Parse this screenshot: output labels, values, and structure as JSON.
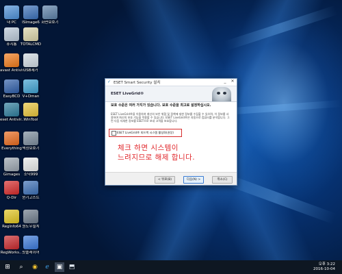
{
  "desktop": {
    "icons": [
      {
        "label": "내 PC",
        "color": "#4d8fd6"
      },
      {
        "label": "ISImage6",
        "color": "#3a6fb8"
      },
      {
        "label": "화면보호기",
        "color": "#5b7fa6"
      },
      {
        "label": "휴지통",
        "color": "#b9c7d6"
      },
      {
        "label": "TOTALCMD",
        "color": "#d9d2a8"
      },
      {
        "label": "avast Antivir...",
        "color": "#f07a1a"
      },
      {
        "label": "USB제거",
        "color": "#cfd8e0"
      },
      {
        "label": "EasyBCD",
        "color": "#2f5ea8"
      },
      {
        "label": "V+Dman",
        "color": "#3fa0d0"
      },
      {
        "label": "eset Antivir...",
        "color": "#2d7c9c"
      },
      {
        "label": "WinTool",
        "color": "#e8c33a"
      },
      {
        "label": "Everything",
        "color": "#e86a1e"
      },
      {
        "label": "액정보호기",
        "color": "#7b8b9b"
      },
      {
        "label": "Gimages",
        "color": "#9aa4ae"
      },
      {
        "label": "소닉999",
        "color": "#e8e8e8"
      },
      {
        "label": "Q-Dir",
        "color": "#d62b2b"
      },
      {
        "label": "윈기고스트",
        "color": "#3c6fb5"
      },
      {
        "label": "RegInfo64",
        "color": "#e0c420"
      },
      {
        "label": "원도우설치",
        "color": "#6d7a8a"
      },
      {
        "label": "RegWorks...",
        "color": "#c8282c"
      },
      {
        "label": "팟플레이어",
        "color": "#3a78d8"
      }
    ]
  },
  "dialog": {
    "title": "ESET Smart Security 설치",
    "header": "ESET LiveGrid®",
    "bold_text": "보호 수준은 여러 가지가 있습니다. 보호 수준을 최고로 설정하십시오.",
    "small_text": "ESET LiveGrid®을 이용하여 최신의 보안 위협 및 정책에 대한 정보를 수집할 수 있으며, 이 정보를 사용하여 최신의 보호 기능을 적용할 수 있습니다. ESET LiveGrid®은 자동으로 컴퓨터를 분석합니다. 그런 다음 자세한 정보를 ESET으로 보내 고객을 보호합니다.",
    "checkbox_label": "ESET LiveGrid® 피드백 시스템 활성화(권장)",
    "note_line1": "체크 하면 시스템이",
    "note_line2": "느려지므로 해제 합니다.",
    "back_button": "< 뒤로(B)",
    "next_button": "다음(N) >",
    "cancel_button": "취소(C)",
    "minimize": "_",
    "close": "✕"
  },
  "taskbar": {
    "start": "⊞",
    "time": "오후 3:22",
    "date": "2016-10-04"
  }
}
